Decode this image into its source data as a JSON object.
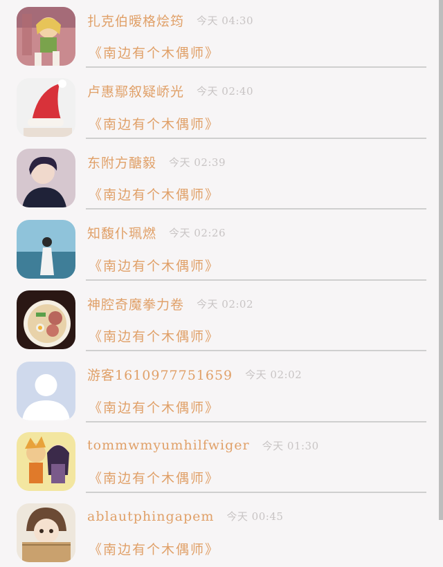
{
  "messages": [
    {
      "name": "扎克伯暧格烩筠",
      "time": "今天 04:30",
      "book": "《南边有个木偶师》",
      "avatar": "anime-girl-avatar"
    },
    {
      "name": "卢惠鄢叙疑峤光",
      "time": "今天 02:40",
      "book": "《南边有个木偶师》",
      "avatar": "santa-hat-avatar"
    },
    {
      "name": "东附方醣毅",
      "time": "今天 02:39",
      "book": "《南边有个木偶师》",
      "avatar": "young-man-avatar"
    },
    {
      "name": "知馥仆珮燃",
      "time": "今天 02:26",
      "book": "《南边有个木偶师》",
      "avatar": "beach-girl-avatar"
    },
    {
      "name": "神腔奇魔拳力卷",
      "time": "今天 02:02",
      "book": "《南边有个木偶师》",
      "avatar": "ramen-avatar"
    },
    {
      "name": "游客1610977751659",
      "time": "今天 02:02",
      "book": "《南边有个木偶师》",
      "avatar": "default-user-avatar"
    },
    {
      "name": "tommwmyumhilfwiger",
      "time": "今天 01:30",
      "book": "《南边有个木偶师》",
      "avatar": "anime-couple-avatar"
    },
    {
      "name": "ablautphingapem",
      "time": "今天 00:45",
      "book": "《南边有个木偶师》",
      "avatar": "chibi-box-avatar"
    }
  ],
  "colors": {
    "accent": "#e0a068",
    "time": "#c8c4c4",
    "divider": "#cfcfcf",
    "background": "#f7f5f6"
  }
}
